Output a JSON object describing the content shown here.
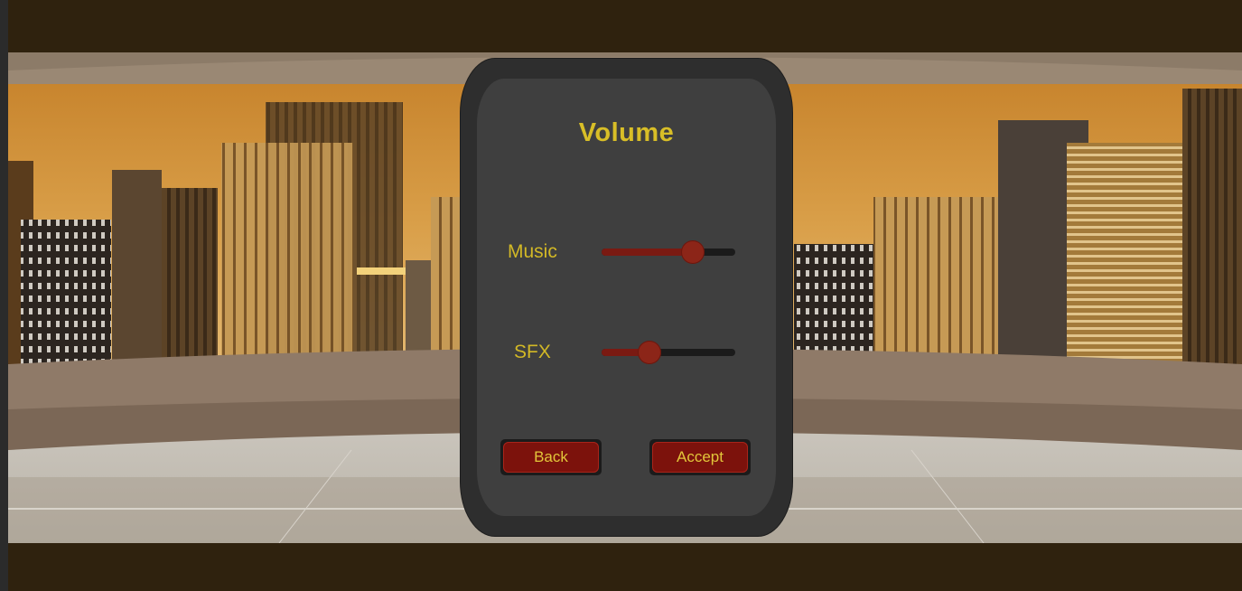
{
  "dialog": {
    "title": "Volume",
    "sliders": [
      {
        "label": "Music",
        "value": 0.68
      },
      {
        "label": "SFX",
        "value": 0.36
      }
    ],
    "buttons": {
      "back": "Back",
      "accept": "Accept"
    }
  },
  "colors": {
    "accent_text": "#d8be27",
    "button_fill": "#7c120c",
    "slider_fill": "#7a1a12",
    "panel": "#3f3f3f"
  }
}
